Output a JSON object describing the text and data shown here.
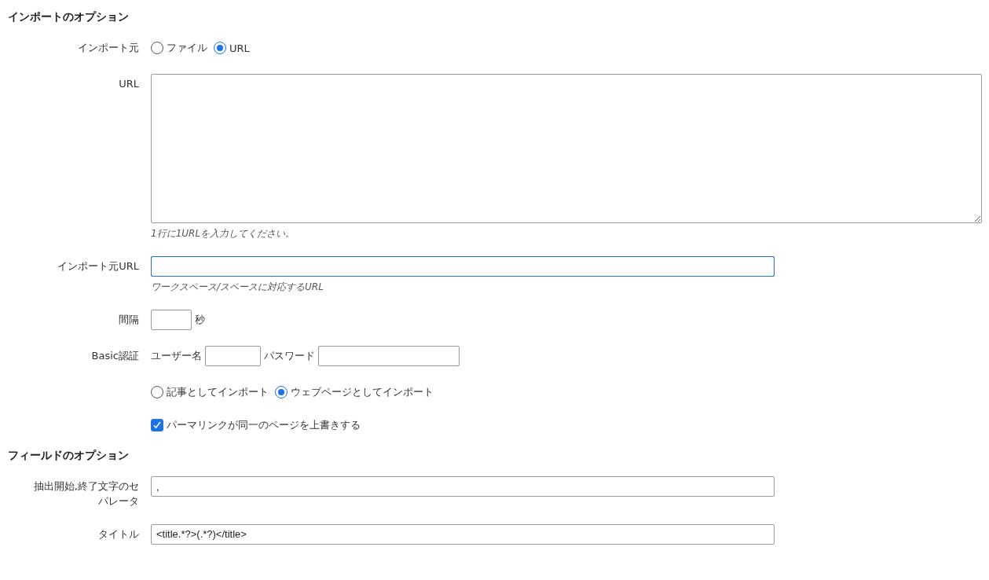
{
  "sections": [
    {
      "title": "インポートのオプション",
      "rows": [
        {
          "kind": "radios",
          "label": "インポート元",
          "options": [
            {
              "label": "ファイル",
              "selected": false
            },
            {
              "label": "URL",
              "selected": true
            }
          ]
        },
        {
          "kind": "textarea",
          "label": "URL",
          "hint": "1行に1URLを入力してください。"
        },
        {
          "kind": "text",
          "label": "インポート元URL",
          "focused": true,
          "hint": "ワークスペース/スペースに対応するURL"
        },
        {
          "kind": "short",
          "label": "間隔",
          "unit": "秒"
        },
        {
          "kind": "auth",
          "label": "Basic認証",
          "user_label": "ユーザー名",
          "password_label": "パスワード"
        },
        {
          "kind": "radios",
          "options": [
            {
              "label": "記事としてインポート",
              "selected": false
            },
            {
              "label": "ウェブページとしてインポート",
              "selected": true
            }
          ]
        },
        {
          "kind": "checkbox",
          "text": "パーマリンクが同一のページを上書きする",
          "checked": true
        }
      ]
    },
    {
      "title": "フィールドのオプション",
      "rows": [
        {
          "kind": "text",
          "label": "抽出開始,終了文字のセパレータ",
          "value": ",",
          "focused": false
        },
        {
          "kind": "text",
          "label": "タイトル",
          "value": "<title.*?>(.*?)</title>",
          "focused": false
        }
      ]
    }
  ]
}
